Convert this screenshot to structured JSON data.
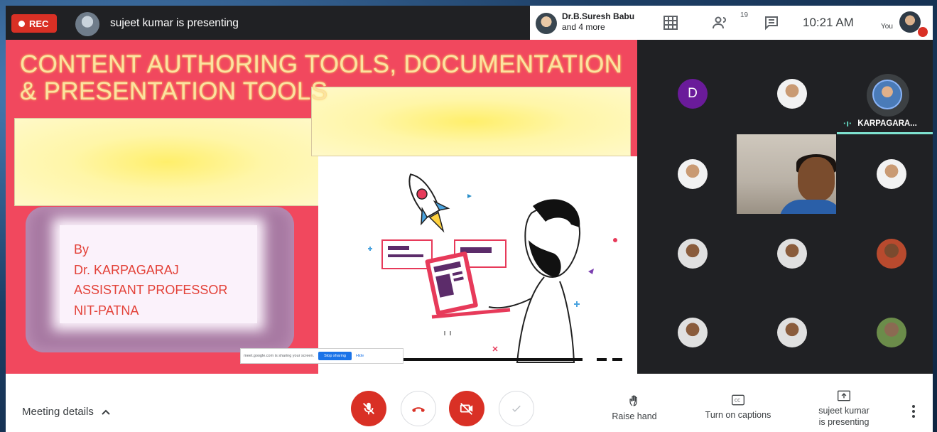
{
  "topbar": {
    "rec_label": "REC",
    "presenting_text": "sujeet kumar is presenting",
    "participants_primary": "Dr.B.Suresh Babu",
    "participants_more": "and 4 more",
    "people_count": "19",
    "time": "10:21 AM",
    "you_label": "You"
  },
  "slide": {
    "title_line1": "CONTENT AUTHORING TOOLS, DOCUMENTATION",
    "title_line2": "& PRESENTATION TOOLS",
    "author_lines": [
      "By",
      "Dr. KARPAGARAJ",
      "ASSISTANT PROFESSOR",
      "NIT-PATNA"
    ],
    "share_notice": "meet.google.com is sharing your screen.",
    "stop_sharing": "Stop sharing",
    "hide": "Hide"
  },
  "tiles": {
    "letter_avatar": "D",
    "active_speaker": "KARPAGARA..."
  },
  "bottombar": {
    "meeting_details": "Meeting details",
    "raise_hand": "Raise hand",
    "captions": "Turn on captions",
    "presenting_line1": "sujeet kumar",
    "presenting_line2": "is presenting"
  },
  "colors": {
    "slide_background": "#f1485e",
    "recording_red": "#d93025",
    "speaker_accent": "#7ee2d0",
    "letter_avatar": "#6a1b9a"
  }
}
